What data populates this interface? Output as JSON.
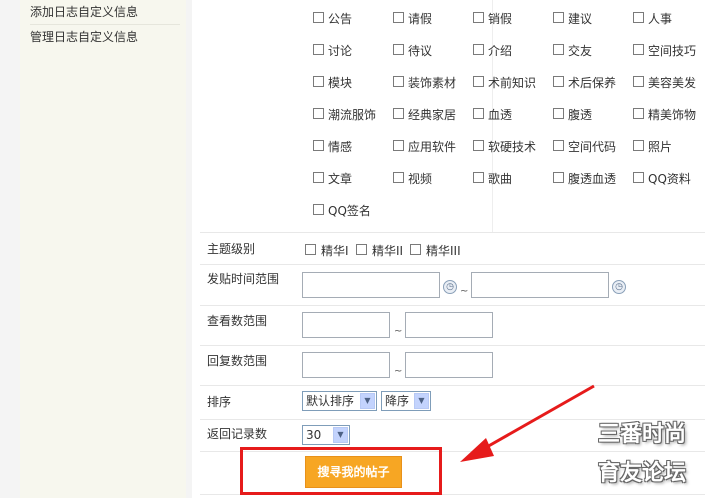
{
  "sidebar": {
    "items": [
      {
        "label": "添加日志自定义信息"
      },
      {
        "label": "管理日志自定义信息"
      }
    ]
  },
  "categories": [
    "公告",
    "请假",
    "销假",
    "建议",
    "人事",
    "讨论",
    "待议",
    "介绍",
    "交友",
    "空间技巧",
    "模块",
    "装饰素材",
    "术前知识",
    "术后保养",
    "美容美发",
    "潮流服饰",
    "经典家居",
    "血透",
    "腹透",
    "精美饰物",
    "情感",
    "应用软件",
    "软硬技术",
    "空间代码",
    "照片",
    "文章",
    "视频",
    "歌曲",
    "腹透血透",
    "QQ资料",
    "QQ签名"
  ],
  "form": {
    "level_label": "主题级别",
    "levels": [
      "精华I",
      "精华II",
      "精华III"
    ],
    "time_range_label": "发贴时间范围",
    "views_range_label": "查看数范围",
    "replies_range_label": "回复数范围",
    "range_sep": "~",
    "sort_label": "排序",
    "sort_value": "默认排序",
    "order_value": "降序",
    "count_label": "返回记录数",
    "count_value": "30"
  },
  "search_button": "搜寻我的帖子",
  "watermark": {
    "line1": "三番时尚",
    "line2": "育友论坛"
  },
  "colors": {
    "accent_button": "#f7a623",
    "annotation_red": "#e61b1b"
  }
}
